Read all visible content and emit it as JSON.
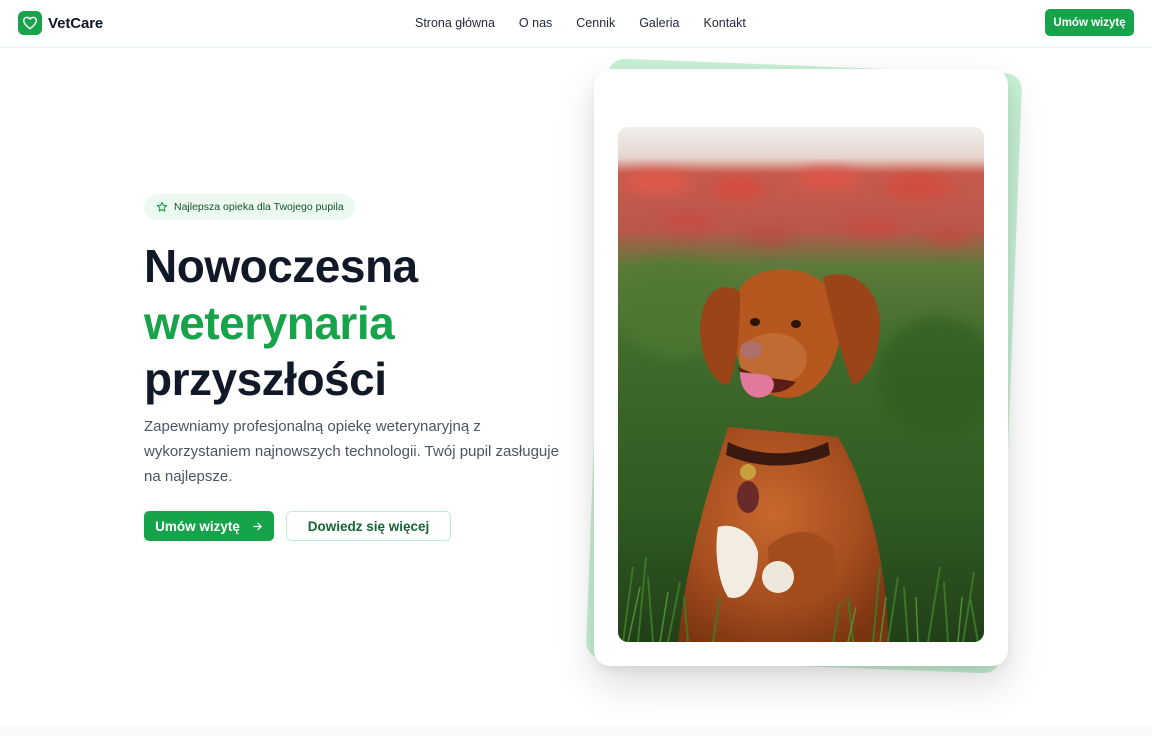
{
  "header": {
    "logo": {
      "text": "VetCare",
      "icon": "heart-icon"
    },
    "nav": [
      {
        "label": "Strona główna"
      },
      {
        "label": "O nas"
      },
      {
        "label": "Cennik"
      },
      {
        "label": "Galeria"
      },
      {
        "label": "Kontakt"
      }
    ],
    "cta_label": "Umów wizytę"
  },
  "hero": {
    "badge": {
      "text": "Najlepsza opieka dla Twojego pupila",
      "icon": "star-icon"
    },
    "title_line1": "Nowoczesna",
    "title_line2": "weterynaria",
    "title_line3": "przyszłości",
    "description": "Zapewniamy profesjonalną opiekę weterynaryjną z wykorzystaniem najnowszych technologii. Twój pupil zasługuje na najlepsze.",
    "primary_button": {
      "label": "Umów wizytę",
      "icon": "arrow-right-icon"
    },
    "secondary_button": {
      "label": "Dowiedz się więcej"
    }
  },
  "colors": {
    "accent": "#16a34a",
    "accent_light": "#ebf9f0",
    "card_back": "#c7f0d4",
    "heading": "#111827",
    "body_text": "#4b5563"
  }
}
